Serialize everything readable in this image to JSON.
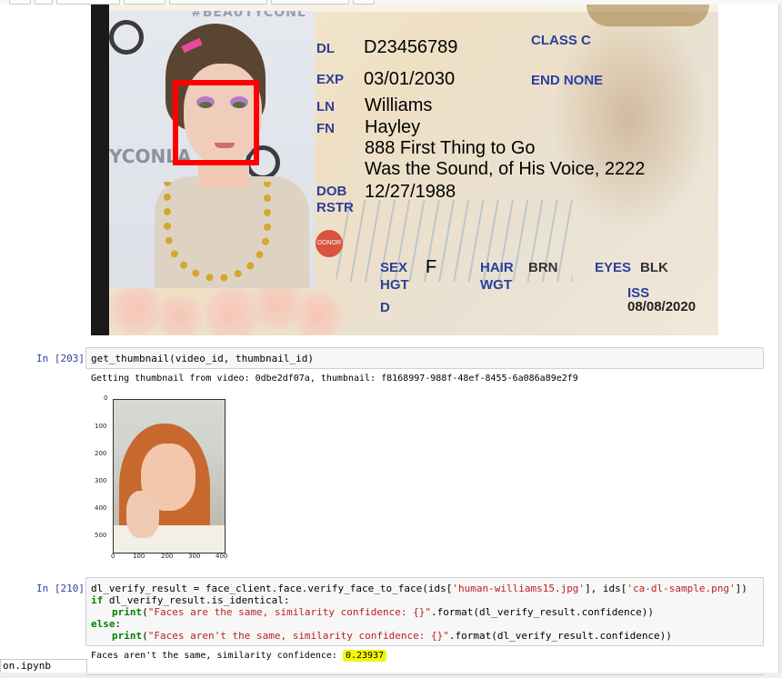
{
  "id_card": {
    "labels": {
      "dl": "DL",
      "exp": "EXP",
      "ln": "LN",
      "fn": "FN",
      "dob": "DOB",
      "rstr": "RSTR",
      "class": "CLASS C",
      "end": "END NONE",
      "sex": "SEX",
      "hgt": "HGT",
      "hair": "HAIR",
      "wgt": "WGT",
      "eyes": "EYES",
      "iss": "ISS",
      "dd": "D",
      "donor": "DONOR"
    },
    "values": {
      "dl_number": "D23456789",
      "exp_date": "03/01/2030",
      "last_name": "Williams",
      "first_name": "Hayley",
      "address_line1": "888 First Thing to Go",
      "address_line2": "Was the Sound, of His Voice, 2222",
      "dob": "12/27/1988",
      "sex": "F",
      "hair": "BRN",
      "eyes": "BLK",
      "iss_date": "08/08/2020"
    },
    "photo_texts": {
      "banner": "#BEAUTYCONL",
      "bg": "YCONLA"
    }
  },
  "cells": [
    {
      "prompt": "In [203]:",
      "code": "get_thumbnail(video_id, thumbnail_id)",
      "output": "Getting thumbnail from video: 0dbe2df07a, thumbnail: f8168997-988f-48ef-8455-6a086a89e2f9"
    },
    {
      "prompt": "In [210]:",
      "code_lines": {
        "l1a": "dl_verify_result = face_client.face.verify_face_to_face(ids[",
        "l1s1": "'human-williams15.jpg'",
        "l1b": "], ids[",
        "l1s2": "'ca-dl-sample.png'",
        "l1c": "])",
        "l2kw": "if",
        "l2": " dl_verify_result.is_identical:",
        "l3kw": "print",
        "l3a": "(",
        "l3s": "\"Faces are the same, similarity confidence: {}\"",
        "l3b": ".format(dl_verify_result.confidence))",
        "l4kw": "else",
        "l4": ":",
        "l5kw": "print",
        "l5a": "(",
        "l5s": "\"Faces aren't the same, similarity confidence: {}\"",
        "l5b": ".format(dl_verify_result.confidence))"
      },
      "output_text": "Faces aren't the same, similarity confidence: ",
      "output_value": "0.23937"
    }
  ],
  "thumbnail_plot": {
    "y_ticks": [
      "0",
      "100",
      "200",
      "300",
      "400",
      "500"
    ],
    "x_ticks": [
      "0",
      "100",
      "200",
      "300",
      "400"
    ]
  },
  "bottom_tab": "on.ipynb",
  "colors": {
    "prompt": "#303f9f",
    "highlight": "#f5f50a",
    "facebox": "#ff0000",
    "card_label": "#2a3f9a"
  }
}
